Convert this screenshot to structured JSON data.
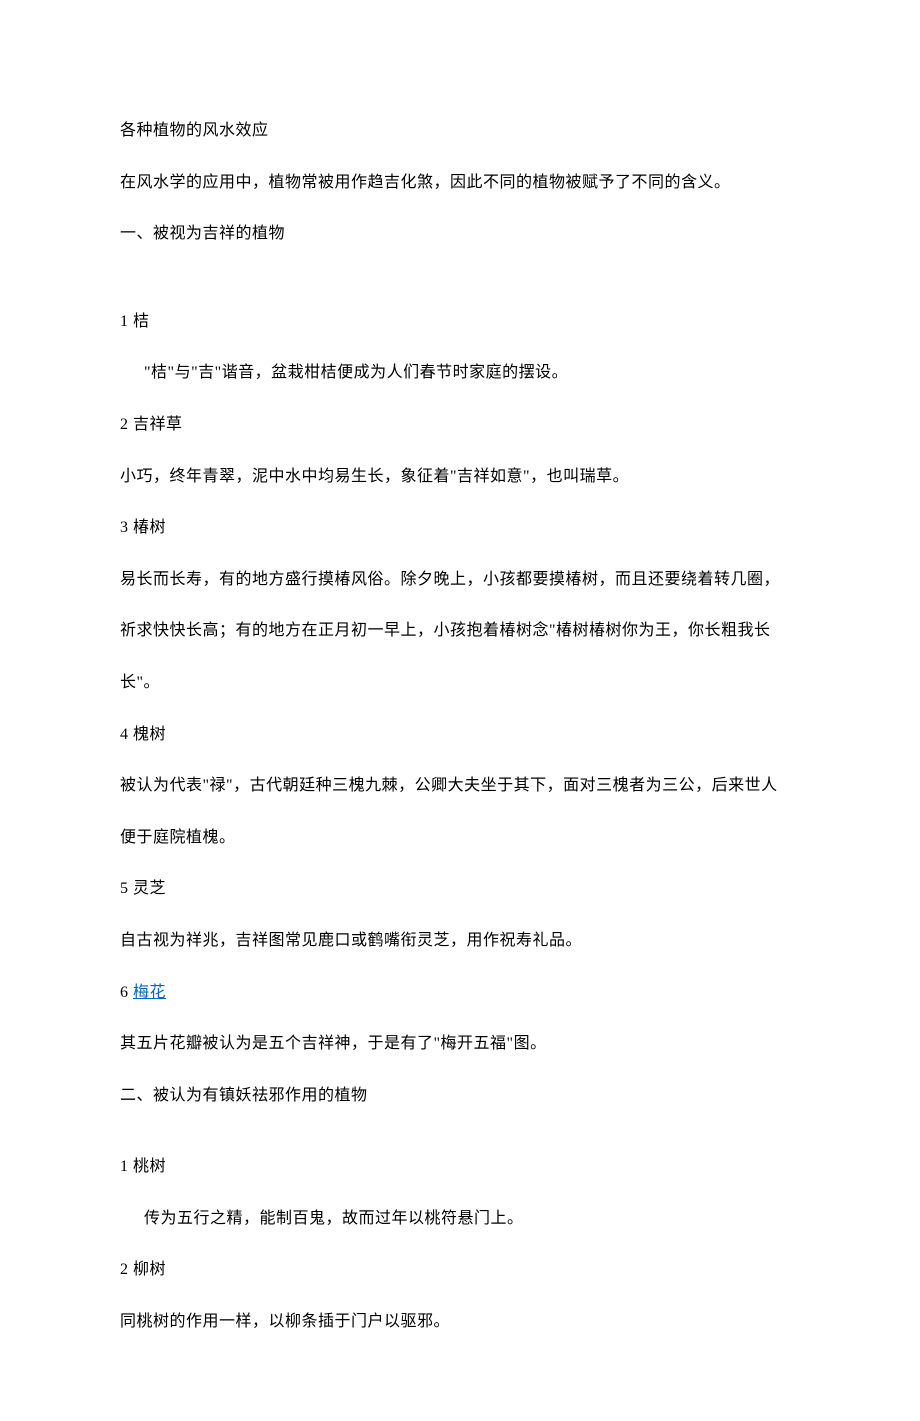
{
  "title": "各种植物的风水效应",
  "intro": "在风水学的应用中，植物常被用作趋吉化煞，因此不同的植物被赋予了不同的含义。",
  "section1_heading": "一、被视为吉祥的植物",
  "item1_num": "1 桔",
  "item1_desc": "\"桔\"与\"吉\"谐音，盆栽柑桔便成为人们春节时家庭的摆设。",
  "item2_num": "2 吉祥草",
  "item2_desc": "小巧，终年青翠，泥中水中均易生长，象征着\"吉祥如意\"，也叫瑞草。",
  "item3_num": "3 椿树",
  "item3_desc_line1": "易长而长寿，有的地方盛行摸椿风俗。除夕晚上，小孩都要摸椿树，而且还要绕着转几圈，",
  "item3_desc_line2": "祈求快快长高；有的地方在正月初一早上，小孩抱着椿树念\"椿树椿树你为王，你长粗我长",
  "item3_desc_line3": "长\"。",
  "item4_num": "4 槐树",
  "item4_desc_line1": "被认为代表\"禄\"，古代朝廷种三槐九棘，公卿大夫坐于其下，面对三槐者为三公，后来世人",
  "item4_desc_line2": "便于庭院植槐。",
  "item5_num": "5 灵芝",
  "item5_desc": "自古视为祥兆，吉祥图常见鹿口或鹤嘴衔灵芝，用作祝寿礼品。",
  "item6_num_prefix": "6 ",
  "item6_link": "梅花",
  "item6_desc": "其五片花瓣被认为是五个吉祥神，于是有了\"梅开五福\"图。",
  "section2_heading": "二、被认为有镇妖祛邪作用的植物",
  "s2_item1_num": "1 桃树",
  "s2_item1_desc": "传为五行之精，能制百鬼，故而过年以桃符悬门上。",
  "s2_item2_num": "2 柳树",
  "s2_item2_desc": "同桃树的作用一样，以柳条插于门户以驱邪。"
}
